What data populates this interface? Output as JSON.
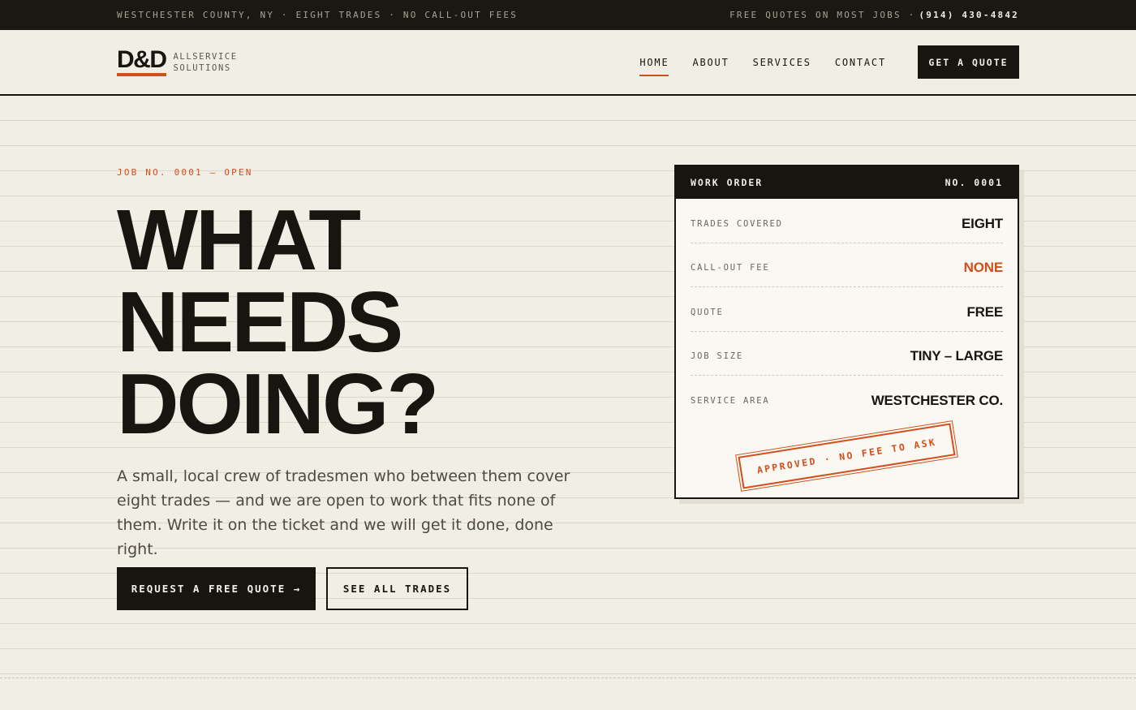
{
  "topbar": {
    "left": "WESTCHESTER COUNTY, NY · EIGHT TRADES · NO CALL-OUT FEES",
    "right_label": "FREE QUOTES ON MOST JOBS ·",
    "phone": "(914) 430-4842"
  },
  "brand": {
    "logo": "D&D",
    "sub_line1": "ALLSERVICE",
    "sub_line2": "SOLUTIONS"
  },
  "nav": {
    "items": [
      {
        "label": "HOME",
        "active": true
      },
      {
        "label": "ABOUT"
      },
      {
        "label": "SERVICES"
      },
      {
        "label": "CONTACT"
      }
    ],
    "cta": "GET A QUOTE"
  },
  "hero": {
    "eyebrow": "JOB NO. 0001 — OPEN",
    "headline": [
      "WHAT",
      "NEEDS",
      "DOING?"
    ],
    "lede": "A small, local crew of tradesmen who between them cover eight trades — and we are open to work that fits none of them. Write it on the ticket and we will get it done, done right.",
    "primary_button": "REQUEST A FREE QUOTE →",
    "secondary_button": "SEE ALL TRADES"
  },
  "work_order": {
    "title": "WORK ORDER",
    "number": "NO. 0001",
    "rows": [
      {
        "key": "TRADES COVERED",
        "value": "EIGHT"
      },
      {
        "key": "CALL-OUT FEE",
        "value": "NONE"
      },
      {
        "key": "QUOTE",
        "value": "FREE"
      },
      {
        "key": "JOB SIZE",
        "value": "TINY – LARGE"
      },
      {
        "key": "SERVICE AREA",
        "value": "WESTCHESTER CO."
      }
    ],
    "stamp": "APPROVED · NO FEE TO ASK"
  },
  "colors": {
    "background": "#f1eee5",
    "ink": "#17150f",
    "accent": "#d14f1c"
  }
}
